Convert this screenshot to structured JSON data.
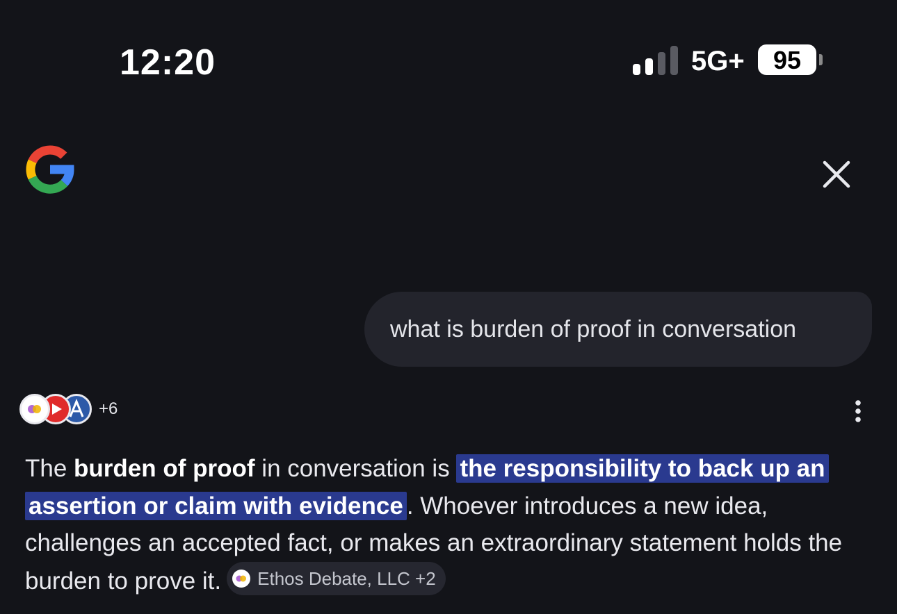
{
  "status_bar": {
    "time": "12:20",
    "network": "5G+",
    "battery": "95",
    "signal_bars_active": 2,
    "signal_bars_total": 4
  },
  "header": {
    "logo_icon": "google-g-icon",
    "close_icon": "close-icon"
  },
  "query": {
    "text": "what is burden of proof in conversation"
  },
  "sources": {
    "icons": [
      "ethos-debate-icon",
      "youtube-icon",
      "source-a-icon"
    ],
    "more_count": "+6",
    "menu_icon": "more-vert-icon"
  },
  "answer": {
    "p1": "The ",
    "bold_term": "burden of proof",
    "p2": " in conversation is ",
    "highlight_1": "the responsibility to back up an",
    "highlight_2": "assertion or claim with evidence",
    "p3": ". Whoever introduces a new idea, challenges an accepted fact, or makes an extraordinary statement holds the burden to prove it.",
    "citation": "Ethos Debate, LLC +2"
  },
  "colors": {
    "background": "#131419",
    "bubble": "#23242c",
    "highlight": "#2a3a8f",
    "chip": "#262730"
  }
}
